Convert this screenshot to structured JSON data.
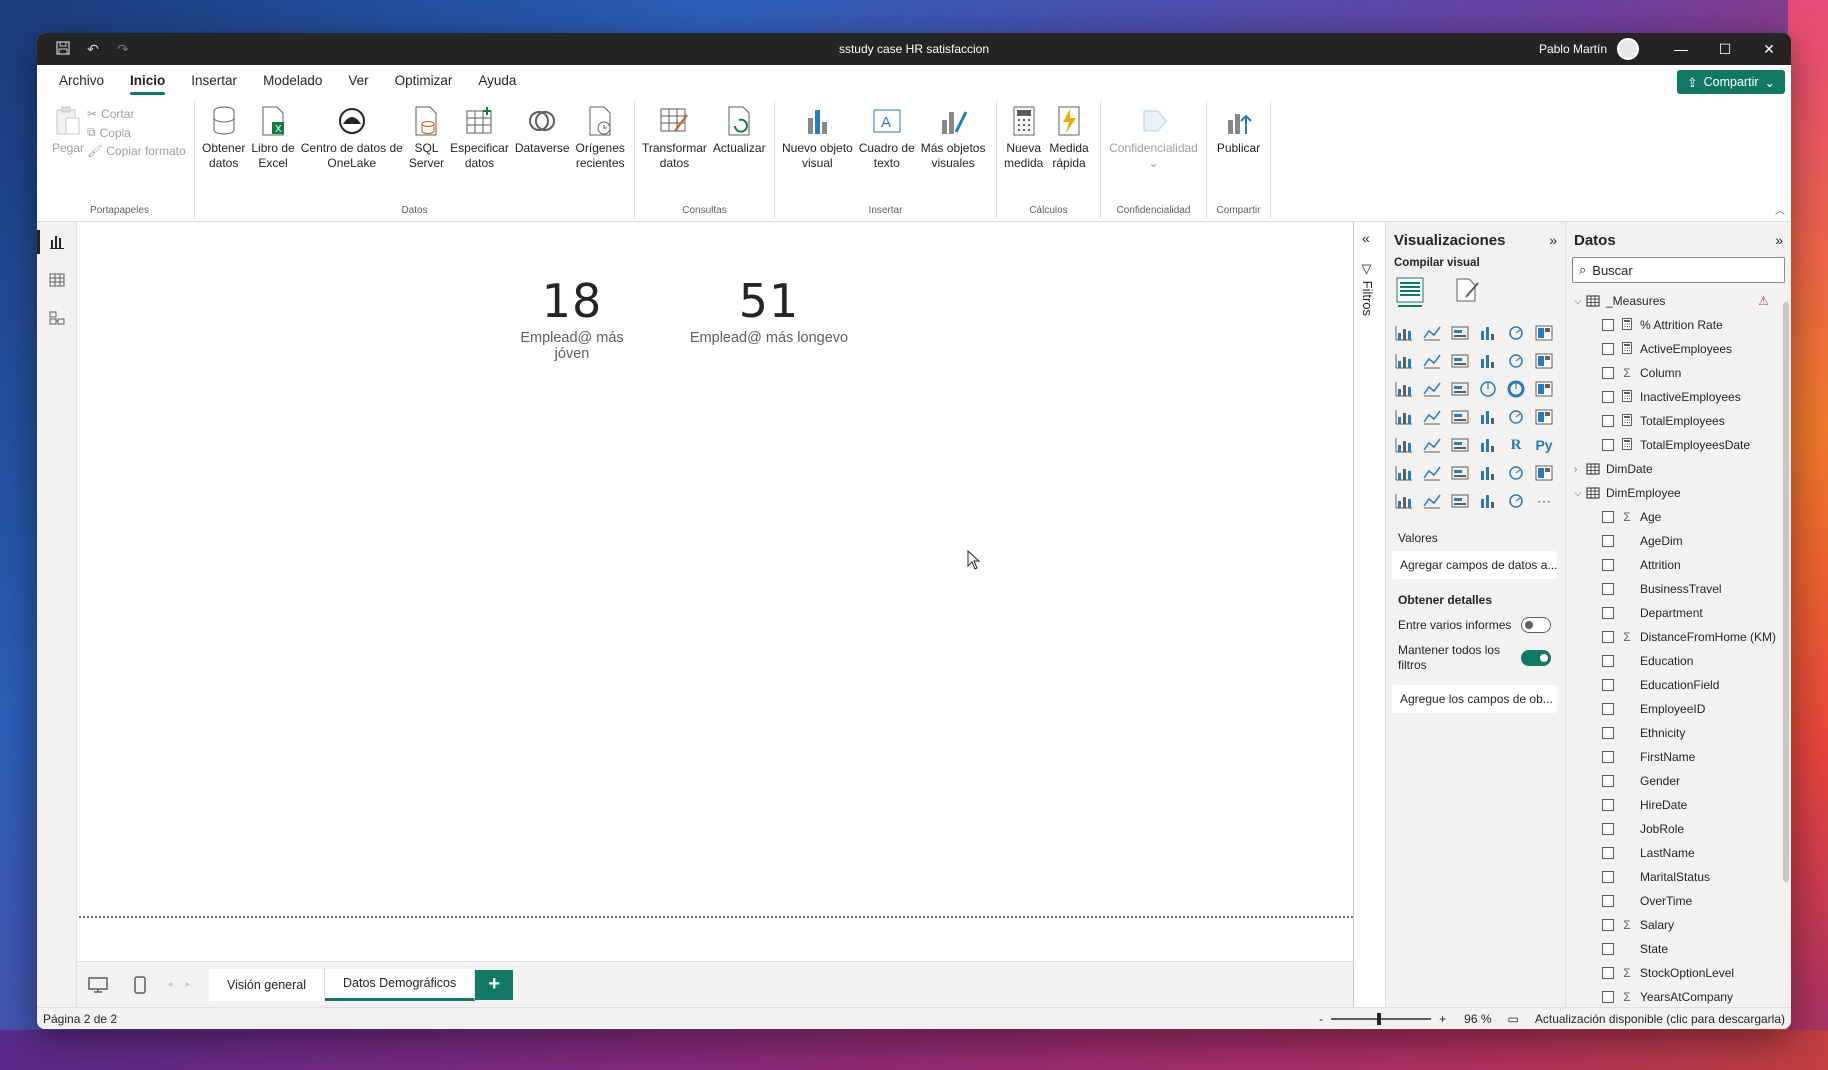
{
  "window": {
    "title": "sstudy case HR satisfaccion",
    "user": "Pablo Martín"
  },
  "menu": {
    "items": [
      "Archivo",
      "Inicio",
      "Insertar",
      "Modelado",
      "Ver",
      "Optimizar",
      "Ayuda"
    ],
    "share_label": "Compartir"
  },
  "ribbon": {
    "clipboard": {
      "paste": "Pegar",
      "cut": "Cortar",
      "copy": "Copia",
      "format": "Copiar formato",
      "group": "Portapapeles"
    },
    "data": {
      "get_data": [
        "Obtener",
        "datos"
      ],
      "excel": [
        "Libro de",
        "Excel"
      ],
      "onelake": [
        "Centro de datos de",
        "OneLake"
      ],
      "sql": [
        "SQL",
        "Server"
      ],
      "enter": [
        "Especificar",
        "datos"
      ],
      "dataverse": "Dataverse",
      "recent": [
        "Orígenes",
        "recientes"
      ],
      "group": "Datos"
    },
    "queries": {
      "transform": [
        "Transformar",
        "datos"
      ],
      "refresh": "Actualizar",
      "group": "Consultas"
    },
    "insert": {
      "new_visual": [
        "Nuevo objeto",
        "visual"
      ],
      "textbox": [
        "Cuadro de",
        "texto"
      ],
      "more": [
        "Más objetos",
        "visuales"
      ],
      "group": "Insertar"
    },
    "calc": {
      "new_measure": [
        "Nueva",
        "medida"
      ],
      "quick": [
        "Medida",
        "rápida"
      ],
      "group": "Cálculos"
    },
    "sens": {
      "label": "Confidencialidad",
      "group": "Confidencialidad"
    },
    "share": {
      "publish": "Publicar",
      "group": "Compartir"
    }
  },
  "canvas": {
    "cards": [
      {
        "value": "18",
        "label": "Emplead@ más jóven"
      },
      {
        "value": "51",
        "label": "Emplead@ más longevo"
      }
    ]
  },
  "pages": {
    "tabs": [
      "Visión general",
      "Datos Demográficos"
    ],
    "active_index": 1
  },
  "filters": {
    "label": "Filtros"
  },
  "viz_pane": {
    "title": "Visualizaciones",
    "build_label": "Compilar visual",
    "values_label": "Valores",
    "values_placeholder": "Agregar campos de datos a...",
    "drill_label": "Obtener detalles",
    "cross_report": "Entre varios informes",
    "keep_filters": [
      "Mantener todos los",
      "filtros"
    ],
    "drill_placeholder": "Agregue los campos de ob..."
  },
  "data_pane": {
    "title": "Datos",
    "search_placeholder": "Buscar",
    "tables": [
      {
        "name": "_Measures",
        "expanded": true,
        "warning": true,
        "fields": [
          {
            "name": "% Attrition Rate",
            "icon": "calc-icon"
          },
          {
            "name": "ActiveEmployees",
            "icon": "calc-icon"
          },
          {
            "name": "Column",
            "icon": "sigma-icon"
          },
          {
            "name": "InactiveEmployees",
            "icon": "calc-icon"
          },
          {
            "name": "TotalEmployees",
            "icon": "calc-icon"
          },
          {
            "name": "TotalEmployeesDate",
            "icon": "calc-icon"
          }
        ]
      },
      {
        "name": "DimDate",
        "expanded": false,
        "fields": []
      },
      {
        "name": "DimEmployee",
        "expanded": true,
        "fields": [
          {
            "name": "Age",
            "icon": "sigma-icon"
          },
          {
            "name": "AgeDim",
            "icon": ""
          },
          {
            "name": "Attrition",
            "icon": ""
          },
          {
            "name": "BusinessTravel",
            "icon": ""
          },
          {
            "name": "Department",
            "icon": ""
          },
          {
            "name": "DistanceFromHome (KM)",
            "icon": "sigma-icon"
          },
          {
            "name": "Education",
            "icon": ""
          },
          {
            "name": "EducationField",
            "icon": ""
          },
          {
            "name": "EmployeeID",
            "icon": ""
          },
          {
            "name": "Ethnicity",
            "icon": ""
          },
          {
            "name": "FirstName",
            "icon": ""
          },
          {
            "name": "Gender",
            "icon": ""
          },
          {
            "name": "HireDate",
            "icon": ""
          },
          {
            "name": "JobRole",
            "icon": ""
          },
          {
            "name": "LastName",
            "icon": ""
          },
          {
            "name": "MaritalStatus",
            "icon": ""
          },
          {
            "name": "OverTime",
            "icon": ""
          },
          {
            "name": "Salary",
            "icon": "sigma-icon"
          },
          {
            "name": "State",
            "icon": ""
          },
          {
            "name": "StockOptionLevel",
            "icon": "sigma-icon"
          },
          {
            "name": "YearsAtCompany",
            "icon": "sigma-icon"
          }
        ]
      }
    ]
  },
  "status": {
    "page": "Página 2 de 2",
    "zoom_minus": "-",
    "zoom_plus": "+",
    "zoom": "96 %",
    "update": "Actualización disponible (clic para descargarla)"
  },
  "colors": {
    "accent": "#117865",
    "titlebar": "#252423",
    "warning": "#d13438"
  }
}
